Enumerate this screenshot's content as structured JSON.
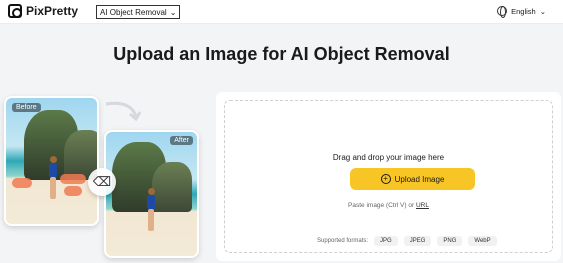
{
  "header": {
    "brand": "PixPretty",
    "tool_select": "AI Object Removal",
    "language": "English"
  },
  "hero": {
    "title": "Upload an Image for AI Object Removal"
  },
  "demo": {
    "before_label": "Before",
    "after_label": "After"
  },
  "upload": {
    "drag_text": "Drag and drop your image here",
    "button_label": "Upload Image",
    "paste_text": "Paste image (Ctrl V) or",
    "paste_link": "URL",
    "formats_label": "Supported formats:",
    "formats": [
      "JPG",
      "JPEG",
      "PNG",
      "WebP"
    ]
  },
  "colors": {
    "accent": "#f8c526",
    "background": "#f3f4f6"
  }
}
